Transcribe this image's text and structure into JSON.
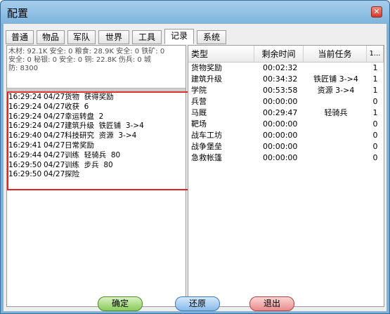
{
  "window": {
    "title": "配置",
    "close_label": "✕"
  },
  "tabs": [
    "普通",
    "物品",
    "军队",
    "世界",
    "工具",
    "记录",
    "系统"
  ],
  "active_tab": "记录",
  "stats": {
    "line1": "木材: 92.1K 安全: 0  粮食: 28.9K 安全: 0  铁矿: 0",
    "line2": "安全: 0  秘银: 0 安全: 0  铜: 22.8K  伤兵: 0  城",
    "line3": "防: 8300"
  },
  "log": [
    {
      "time": "16:29:24",
      "date": "04/27",
      "text": "货物  获得奖励"
    },
    {
      "time": "16:29:24",
      "date": "04/27",
      "text": "收获  6"
    },
    {
      "time": "16:29:24",
      "date": "04/27",
      "text": "幸运转盘  2"
    },
    {
      "time": "16:29:24",
      "date": "04/27",
      "text": "建筑升级  铁匠铺  3->4"
    },
    {
      "time": "16:29:40",
      "date": "04/27",
      "text": "科技研究  资源  3->4"
    },
    {
      "time": "16:29:41",
      "date": "04/27",
      "text": "日常奖励"
    },
    {
      "time": "16:29:44",
      "date": "04/27",
      "text": "训练  轻骑兵  80"
    },
    {
      "time": "16:29:50",
      "date": "04/27",
      "text": "训练  步兵  80"
    },
    {
      "time": "16:29:50",
      "date": "04/27",
      "text": "探险"
    }
  ],
  "table": {
    "headers": [
      "类型",
      "剩余时间",
      "当前任务",
      "1..."
    ],
    "rows": [
      {
        "type": "货物奖励",
        "remaining": "00:02:32",
        "task": "",
        "n": "1"
      },
      {
        "type": "建筑升级",
        "remaining": "00:34:32",
        "task": "铁匠铺 3->4",
        "n": "1"
      },
      {
        "type": "学院",
        "remaining": "00:53:58",
        "task": "资源 3->4",
        "n": "1"
      },
      {
        "type": "兵营",
        "remaining": "00:00:00",
        "task": "",
        "n": "0"
      },
      {
        "type": "马厩",
        "remaining": "00:29:47",
        "task": "轻骑兵",
        "n": "1"
      },
      {
        "type": "靶场",
        "remaining": "00:00:00",
        "task": "",
        "n": "0"
      },
      {
        "type": "战车工坊",
        "remaining": "00:00:00",
        "task": "",
        "n": "0"
      },
      {
        "type": "战争堡垒",
        "remaining": "00:00:00",
        "task": "",
        "n": "0"
      },
      {
        "type": "急救帐篷",
        "remaining": "00:00:00",
        "task": "",
        "n": "0"
      }
    ]
  },
  "buttons": {
    "ok": "确定",
    "reset": "还原",
    "quit": "退出"
  }
}
